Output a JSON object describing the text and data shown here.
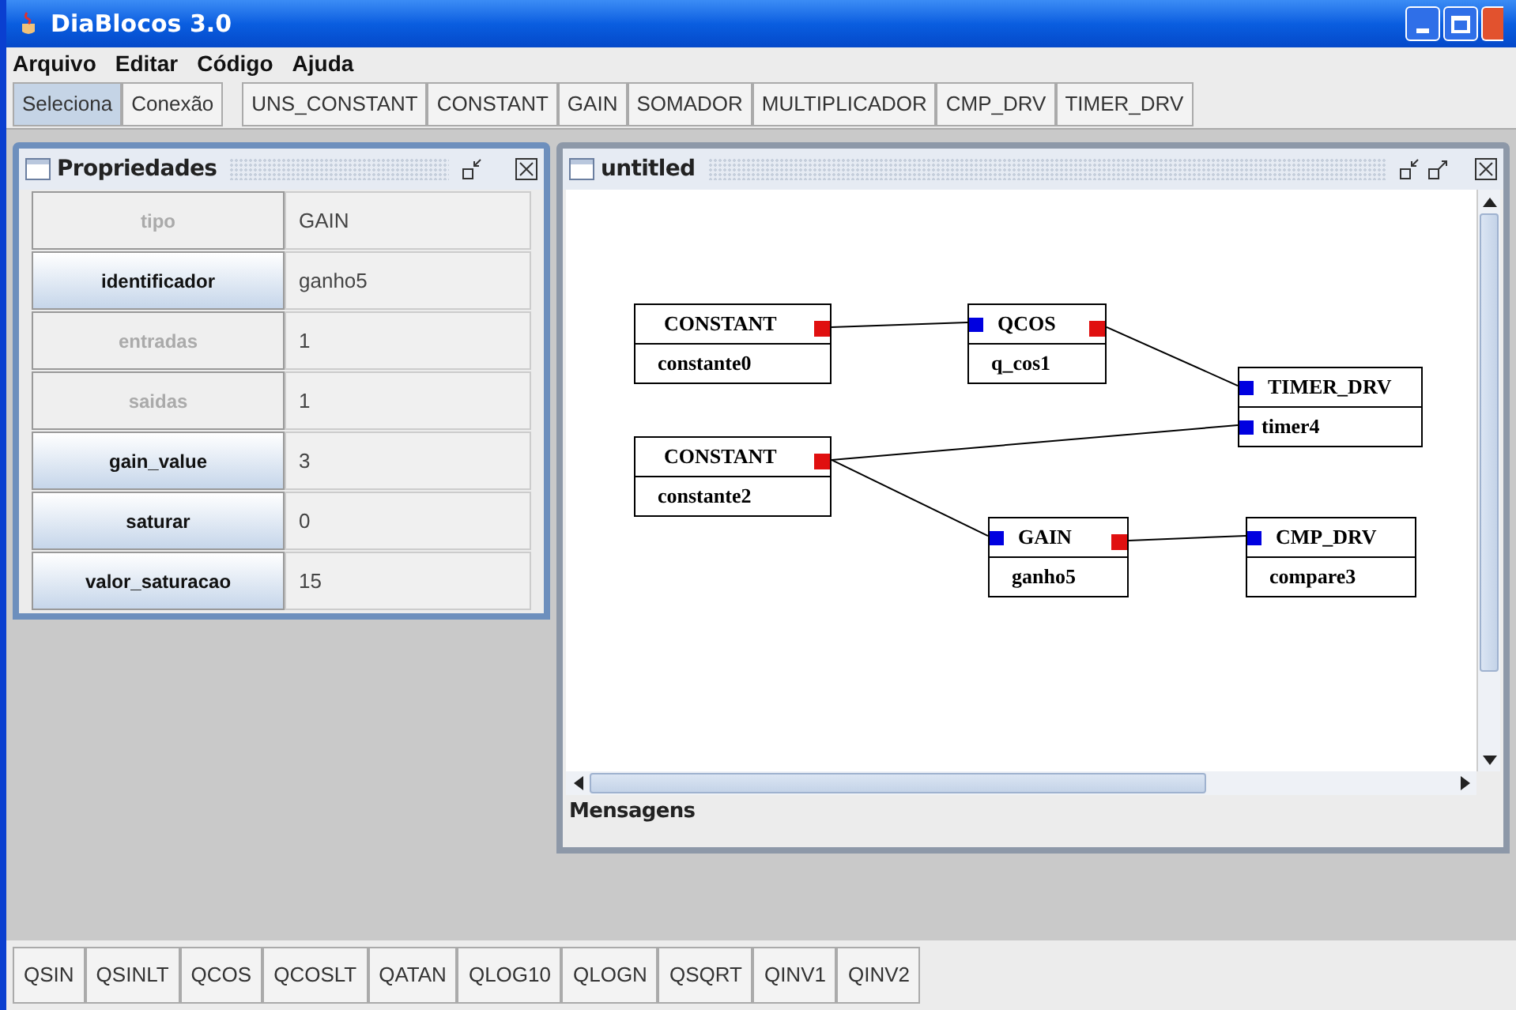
{
  "window": {
    "title": "DiaBlocos 3.0"
  },
  "menu": [
    "Arquivo",
    "Editar",
    "Código",
    "Ajuda"
  ],
  "mode_tools": [
    {
      "label": "Seleciona",
      "selected": true
    },
    {
      "label": "Conexão",
      "selected": false
    }
  ],
  "block_tools": [
    "UNS_CONSTANT",
    "CONSTANT",
    "GAIN",
    "SOMADOR",
    "MULTIPLICADOR",
    "CMP_DRV",
    "TIMER_DRV"
  ],
  "properties": {
    "title": "Propriedades",
    "rows": [
      {
        "name": "tipo",
        "value": "GAIN",
        "disabled": true
      },
      {
        "name": "identificador",
        "value": "ganho5",
        "disabled": false
      },
      {
        "name": "entradas",
        "value": "1",
        "disabled": true
      },
      {
        "name": "saidas",
        "value": "1",
        "disabled": true
      },
      {
        "name": "gain_value",
        "value": "3",
        "disabled": false
      },
      {
        "name": "saturar",
        "value": "0",
        "disabled": false
      },
      {
        "name": "valor_saturacao",
        "value": "15",
        "disabled": false
      }
    ]
  },
  "diagram": {
    "title": "untitled",
    "blocks": [
      {
        "type": "CONSTANT",
        "name": "constante0"
      },
      {
        "type": "QCOS",
        "name": "q_cos1"
      },
      {
        "type": "TIMER_DRV",
        "name": "timer4"
      },
      {
        "type": "CONSTANT",
        "name": "constante2"
      },
      {
        "type": "GAIN",
        "name": "ganho5"
      },
      {
        "type": "CMP_DRV",
        "name": "compare3"
      }
    ],
    "messages_label": "Mensagens"
  },
  "bottom_tools": [
    "QSIN",
    "QSINLT",
    "QCOS",
    "QCOSLT",
    "QATAN",
    "QLOG10",
    "QLOGN",
    "QSQRT",
    "QINV1",
    "QINV2"
  ]
}
